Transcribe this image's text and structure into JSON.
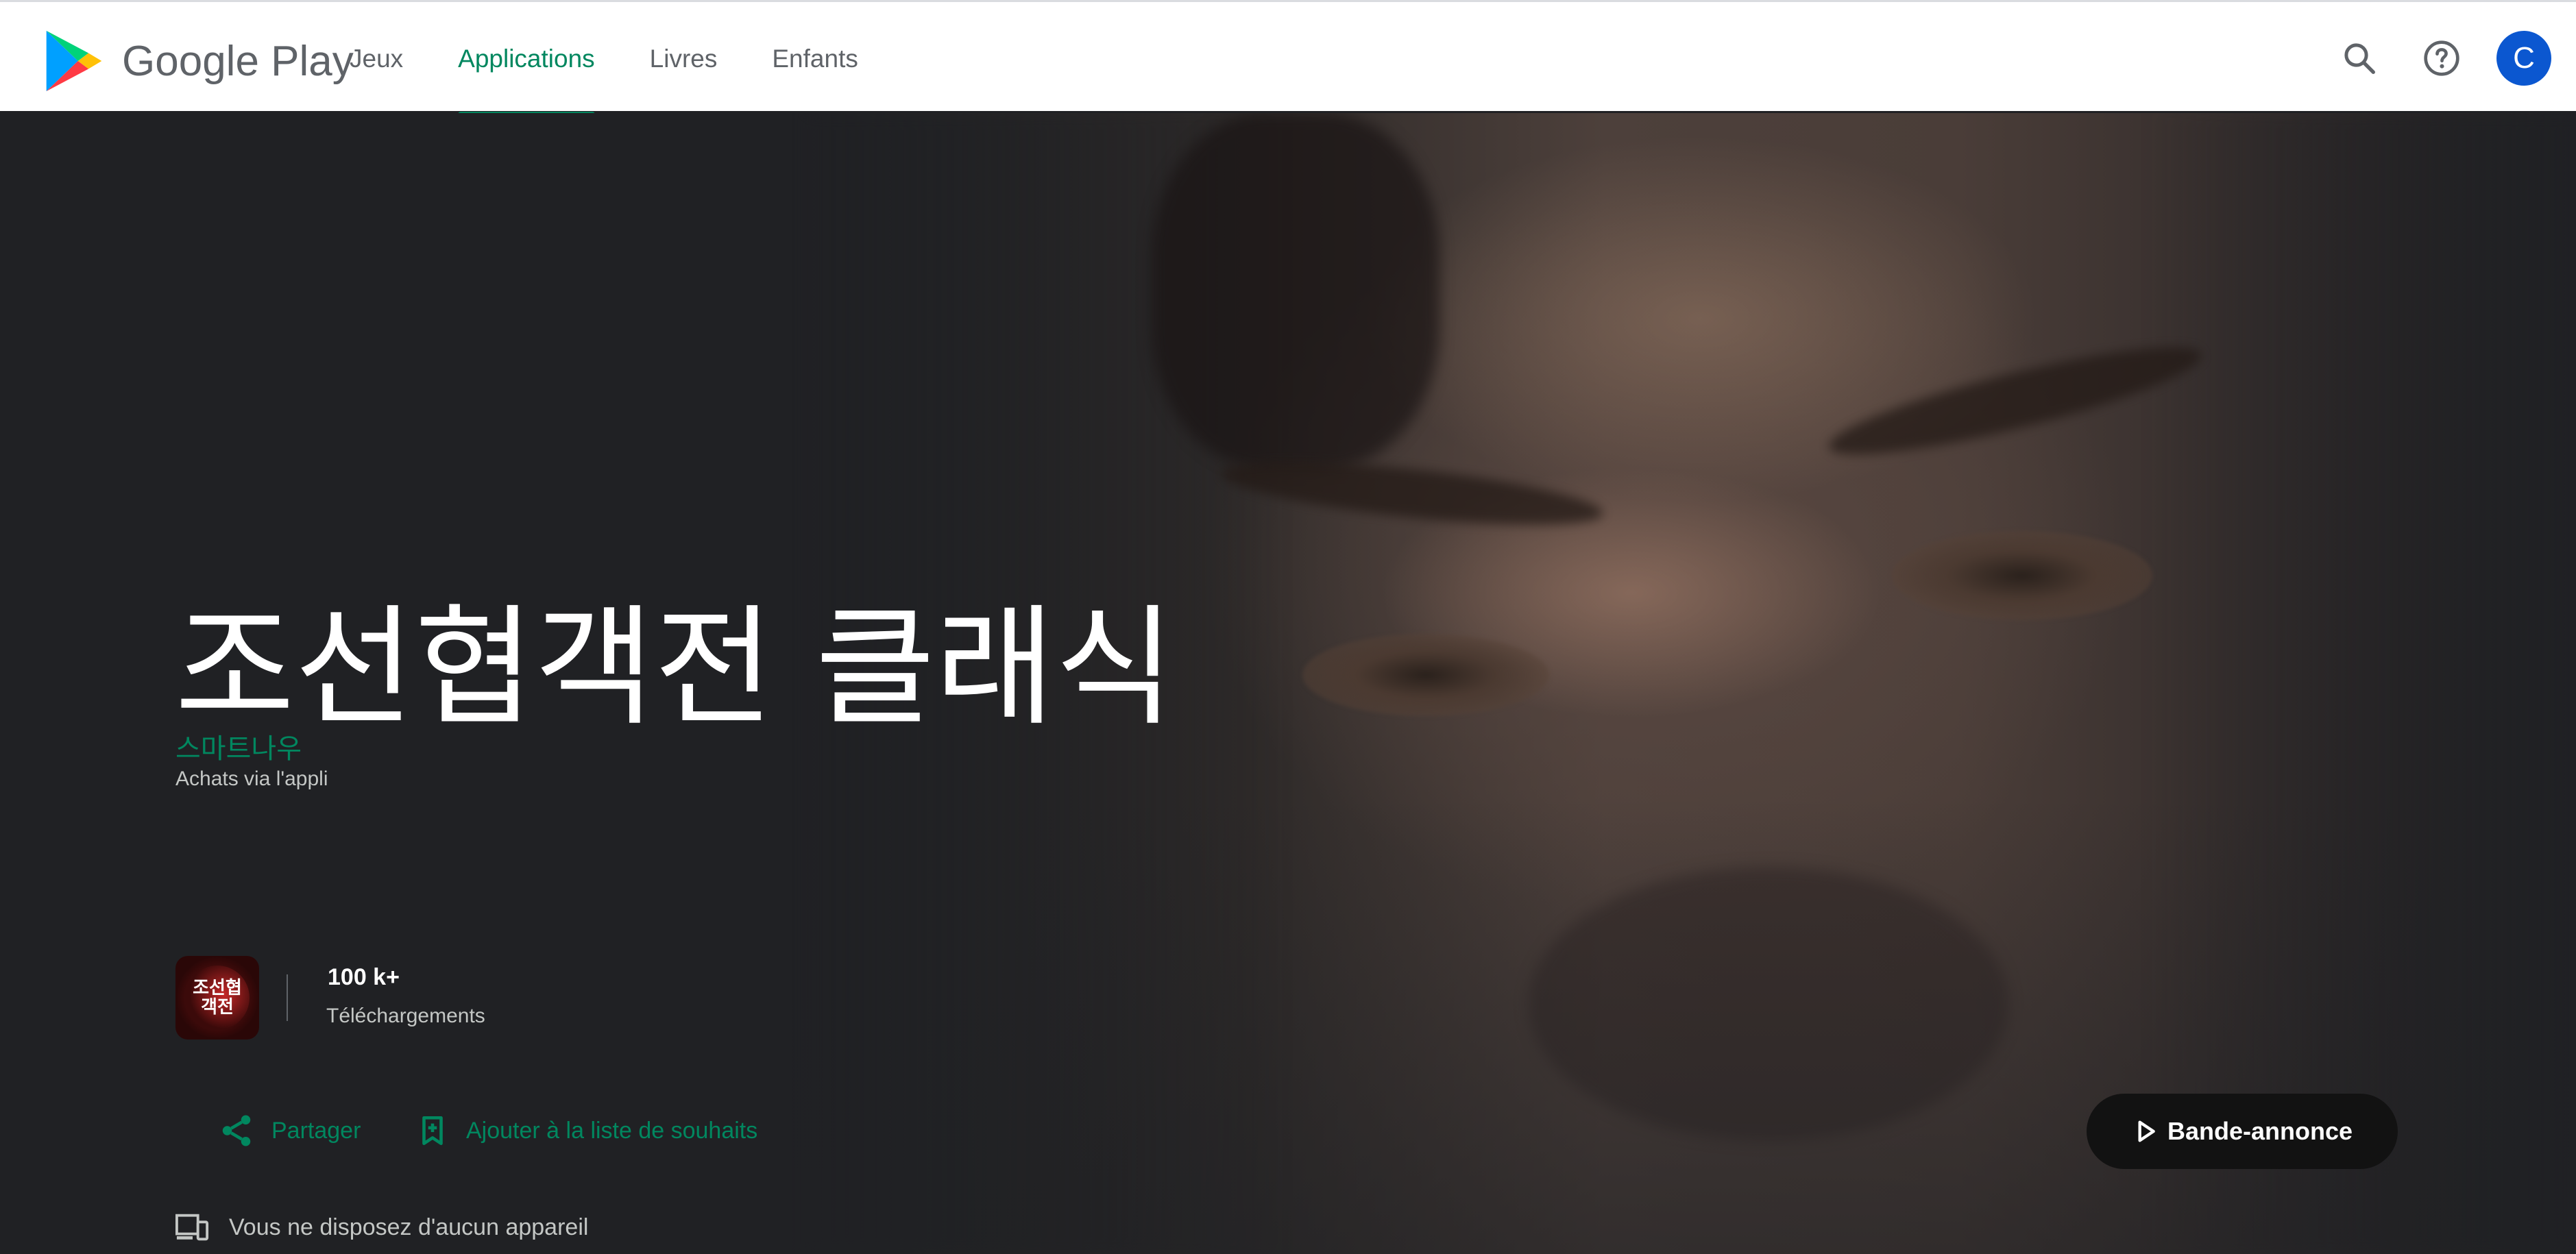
{
  "header": {
    "brand": "Google Play",
    "tabs": [
      {
        "label": "Jeux",
        "active": false
      },
      {
        "label": "Applications",
        "active": true
      },
      {
        "label": "Livres",
        "active": false
      },
      {
        "label": "Enfants",
        "active": false
      }
    ],
    "icons": [
      "search-icon",
      "help-icon"
    ],
    "avatar_letter": "C"
  },
  "app": {
    "title": "조선협객전 클래식",
    "developer": "스마트나우",
    "iap_note": "Achats via l'appli",
    "icon_text": "조선협객전",
    "downloads_value": "100 k+",
    "downloads_label": "Téléchargements"
  },
  "actions": {
    "share": "Partager",
    "wishlist": "Ajouter à la liste de souhaits",
    "trailer": "Bande-annonce"
  },
  "device_note": "Vous ne disposez d'aucun appareil",
  "colors": {
    "accent": "#01875f",
    "hero_bg": "#202124",
    "avatar_bg": "#0b57d0"
  }
}
